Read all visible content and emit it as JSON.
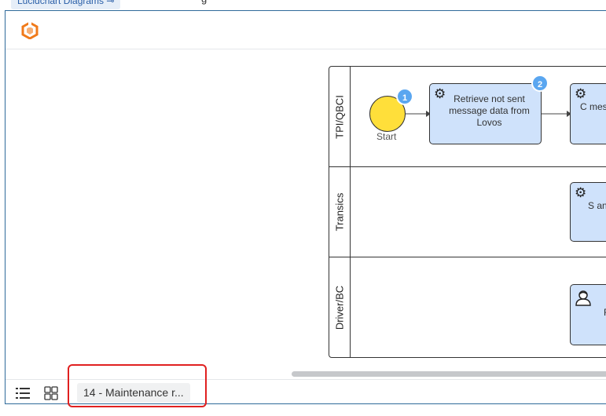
{
  "top": {
    "chip_label": "Lucidchart Diagrams ⊸",
    "fragment": "g"
  },
  "logo": {
    "icon": "lucid-logo-icon",
    "color": "#f07a1a"
  },
  "diagram": {
    "lanes": [
      {
        "label": "TPI/QBCI"
      },
      {
        "label": "Transics"
      },
      {
        "label": "Driver/BC"
      }
    ],
    "start_event": {
      "label": "Start",
      "badge": "1"
    },
    "tasks": [
      {
        "text": "Retrieve not sent message data from Lovos",
        "badge": "2",
        "icon": "gear-icon"
      },
      {
        "text": "C messa",
        "icon": "gear-icon"
      },
      {
        "text": "S anc",
        "icon": "gear-icon"
      },
      {
        "text": "F",
        "icon": "user-icon"
      }
    ],
    "colors": {
      "task_fill": "#cfe2fb",
      "start_fill": "#ffdf3a",
      "badge": "#5aa6f0"
    }
  },
  "footer": {
    "list_view_icon": "list-icon",
    "grid_view_icon": "grid-icon",
    "page_tab_label": "14 - Maintenance r..."
  },
  "highlight_color": "#e02020"
}
